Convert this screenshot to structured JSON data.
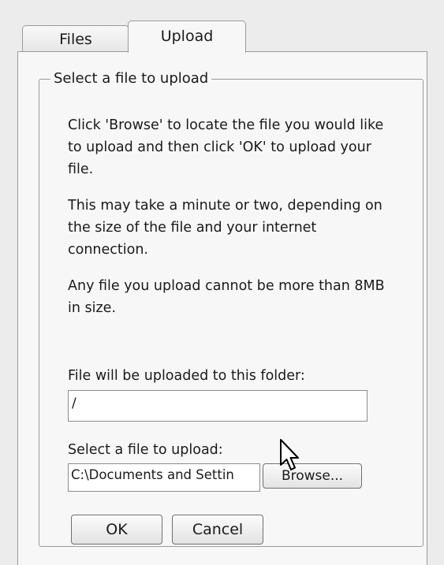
{
  "tabs": [
    {
      "label": "Files",
      "active": false
    },
    {
      "label": "Upload",
      "active": true
    }
  ],
  "group": {
    "title": "Select a file to upload",
    "paragraphs": [
      "Click 'Browse' to locate the file you would like to upload and then click 'OK' to upload your file.",
      "This may take a minute or two, depending on the size of the file and your internet connection.",
      "Any file you upload cannot be more than 8MB in size."
    ],
    "folder_label": "File will be uploaded to this folder:",
    "folder_value": "/",
    "file_label": "Select a file to upload:",
    "file_value": "C:\\Documents and Settin",
    "browse_label": "Browse...",
    "ok_label": "OK",
    "cancel_label": "Cancel"
  },
  "icons": {
    "cursor": "arrow-pointer-icon"
  }
}
